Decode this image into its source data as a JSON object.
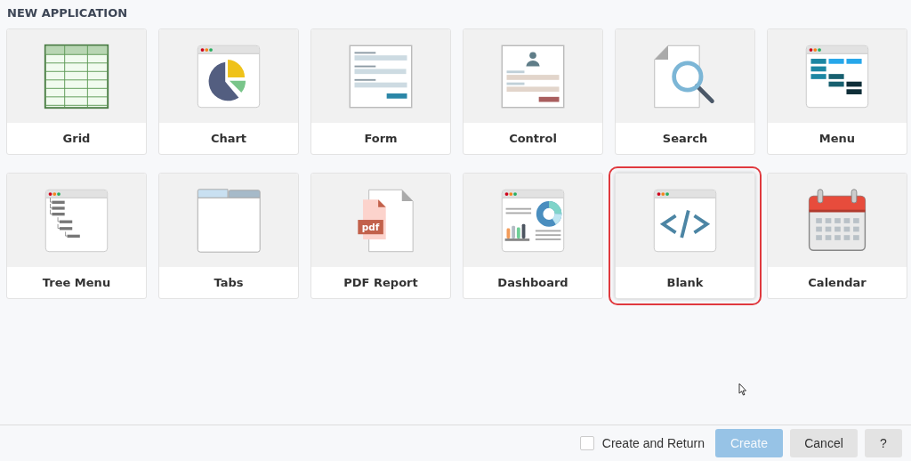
{
  "title": "NEW APPLICATION",
  "cards": [
    {
      "label": "Grid",
      "kind": "grid",
      "selected": false
    },
    {
      "label": "Chart",
      "kind": "chart",
      "selected": false
    },
    {
      "label": "Form",
      "kind": "form",
      "selected": false
    },
    {
      "label": "Control",
      "kind": "control",
      "selected": false
    },
    {
      "label": "Search",
      "kind": "search",
      "selected": false
    },
    {
      "label": "Menu",
      "kind": "menu",
      "selected": false
    },
    {
      "label": "Tree Menu",
      "kind": "tree",
      "selected": false
    },
    {
      "label": "Tabs",
      "kind": "tabs",
      "selected": false
    },
    {
      "label": "PDF Report",
      "kind": "pdf",
      "badge": "pdf",
      "selected": false
    },
    {
      "label": "Dashboard",
      "kind": "dashboard",
      "selected": false
    },
    {
      "label": "Blank",
      "kind": "blank",
      "selected": true
    },
    {
      "label": "Calendar",
      "kind": "calendar",
      "selected": false
    }
  ],
  "footer": {
    "checkbox": {
      "label": "Create and Return",
      "checked": false
    },
    "buttons": [
      {
        "label": "Create",
        "kind": "primary",
        "disabled": true
      },
      {
        "label": "Cancel",
        "kind": "secondary",
        "disabled": false
      },
      {
        "label": "?",
        "kind": "help",
        "disabled": false
      }
    ]
  }
}
